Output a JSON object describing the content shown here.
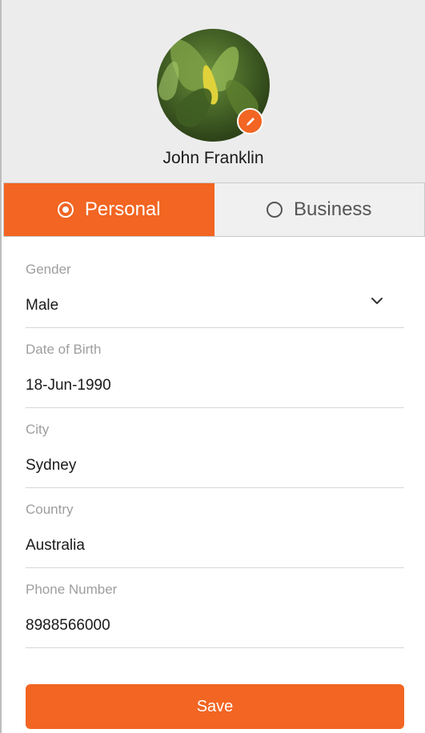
{
  "profile": {
    "name": "John Franklin",
    "avatar_icon": "profile-photo-leaves",
    "edit_icon": "pencil-icon"
  },
  "tabs": [
    {
      "label": "Personal",
      "selected": true
    },
    {
      "label": "Business",
      "selected": false
    }
  ],
  "form": {
    "fields": [
      {
        "label": "Gender",
        "value": "Male",
        "type": "select"
      },
      {
        "label": "Date of Birth",
        "value": "18-Jun-1990",
        "type": "text"
      },
      {
        "label": "City",
        "value": "Sydney",
        "type": "text"
      },
      {
        "label": "Country",
        "value": "Australia",
        "type": "text"
      },
      {
        "label": "Phone Number",
        "value": "8988566000",
        "type": "text"
      }
    ]
  },
  "actions": {
    "save_label": "Save"
  },
  "colors": {
    "accent": "#f26522",
    "header_bg": "#ececec",
    "label": "#9e9e9e",
    "text": "#1a1a1a"
  }
}
